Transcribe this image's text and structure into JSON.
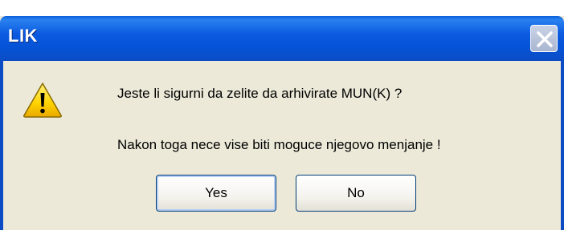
{
  "window": {
    "title": "LIK"
  },
  "dialog": {
    "icon": "warning-icon",
    "message_line1": "Jeste li sigurni da zelite da arhivirate MUN(K) ?",
    "message_line2": "Nakon toga nece vise biti moguce njegovo menjanje !"
  },
  "buttons": {
    "yes_label": "Yes",
    "no_label": "No"
  },
  "colors": {
    "titlebar": "#0553d6",
    "dialog_background": "#ece9d8",
    "warning_yellow": "#ffd200"
  }
}
